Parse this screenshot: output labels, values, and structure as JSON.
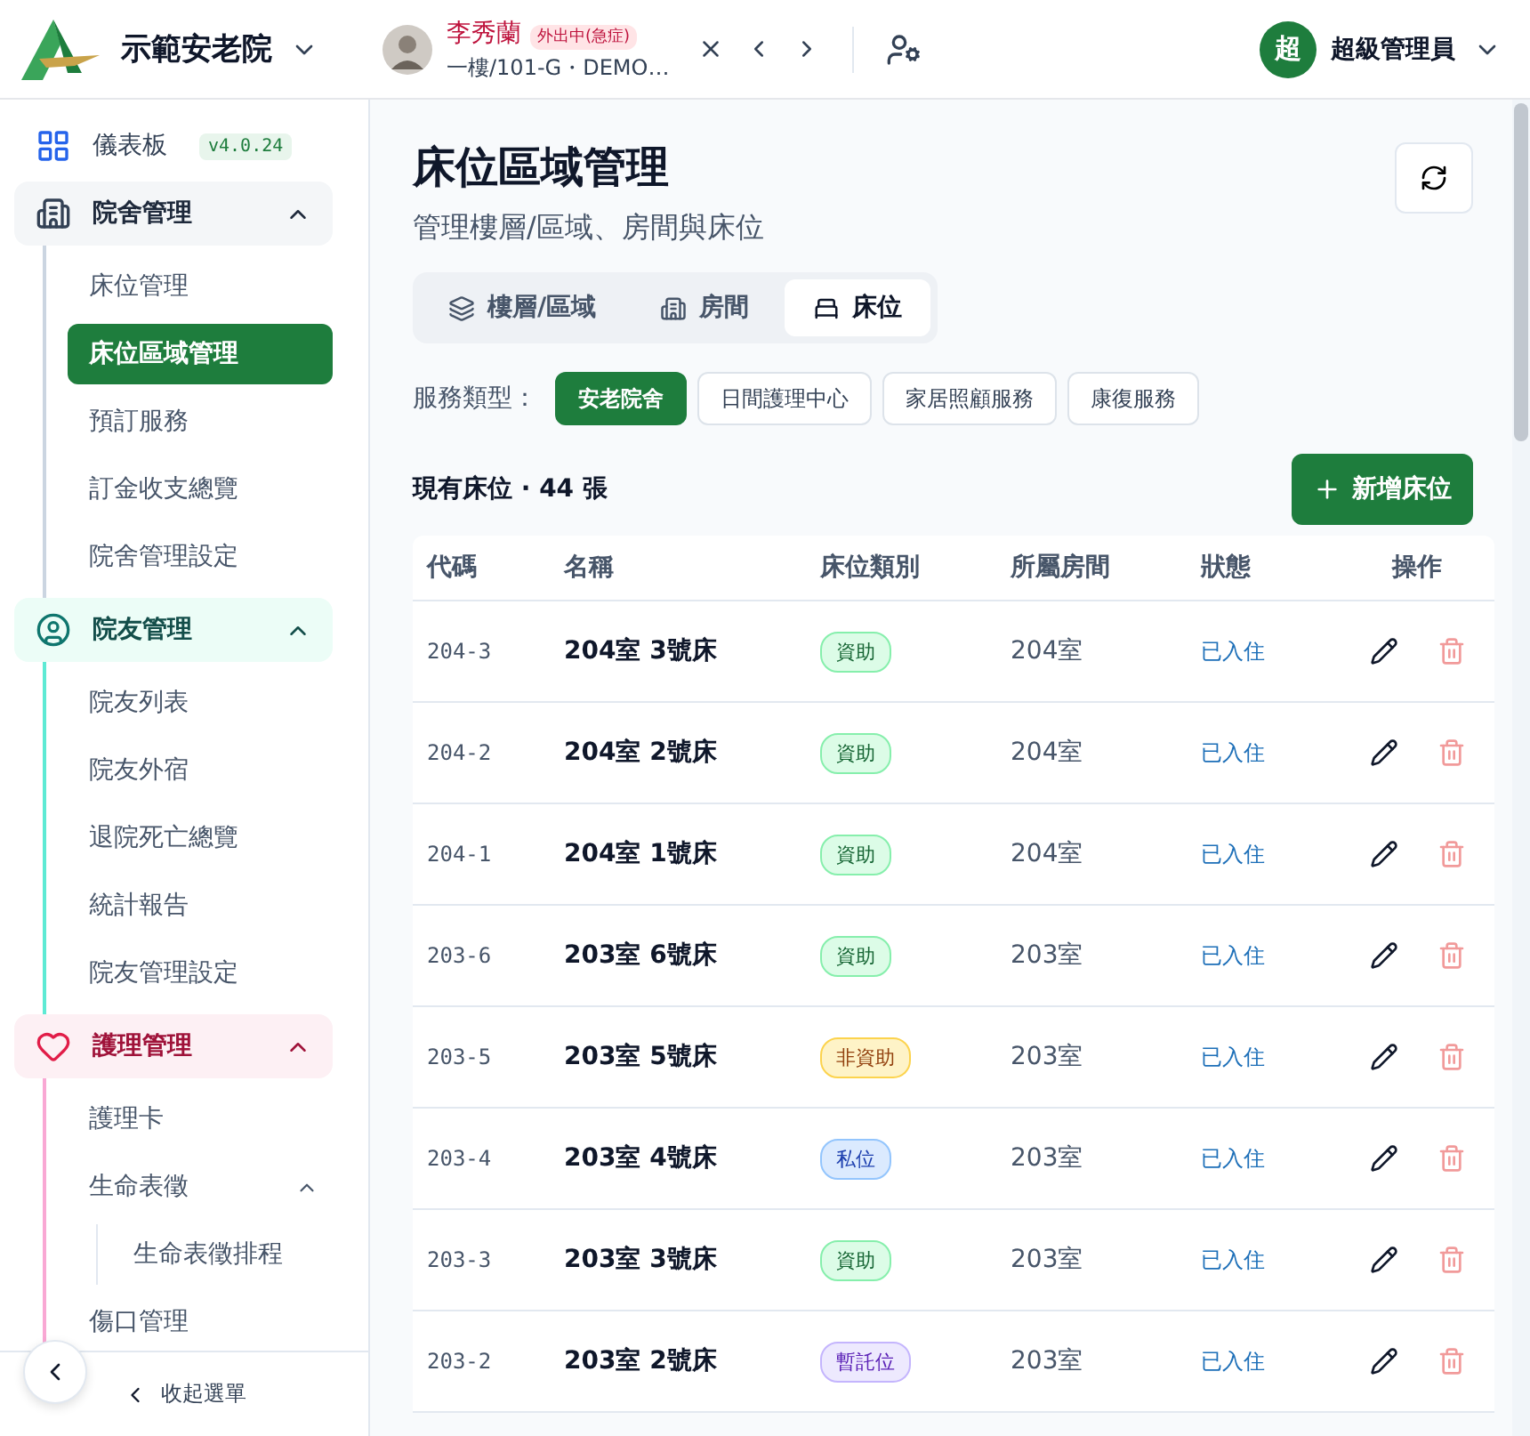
{
  "header": {
    "org_name": "示範安老院",
    "resident": {
      "name": "李秀蘭",
      "status_badge": "外出中(急症)",
      "location": "一樓/101-G・DEMO…"
    },
    "user": {
      "initial": "超",
      "name": "超級管理員"
    }
  },
  "sidebar": {
    "dashboard": {
      "label": "儀表板",
      "version": "v4.0.24"
    },
    "groups": [
      {
        "label": "院舍管理",
        "expanded": true,
        "color": "#cbd5e1",
        "items": [
          {
            "label": "床位管理",
            "selected": false
          },
          {
            "label": "床位區域管理",
            "selected": true
          },
          {
            "label": "預訂服務",
            "selected": false
          },
          {
            "label": "訂金收支總覽",
            "selected": false
          },
          {
            "label": "院舍管理設定",
            "selected": false
          }
        ]
      },
      {
        "label": "院友管理",
        "expanded": true,
        "color": "#5eead4",
        "items": [
          {
            "label": "院友列表",
            "selected": false
          },
          {
            "label": "院友外宿",
            "selected": false
          },
          {
            "label": "退院死亡總覽",
            "selected": false
          },
          {
            "label": "統計報告",
            "selected": false
          },
          {
            "label": "院友管理設定",
            "selected": false
          }
        ]
      },
      {
        "label": "護理管理",
        "expanded": true,
        "color": "#f9a8d4",
        "items": [
          {
            "label": "護理卡",
            "selected": false
          },
          {
            "label": "生命表徵",
            "selected": false,
            "expanded": true,
            "children": [
              {
                "label": "生命表徵排程",
                "selected": false
              }
            ]
          },
          {
            "label": "傷口管理",
            "selected": false
          }
        ]
      }
    ],
    "collapse_label": "收起選單"
  },
  "page": {
    "title": "床位區域管理",
    "subtitle": "管理樓層/區域、房間與床位",
    "tabs": [
      {
        "label": "樓層/區域",
        "selected": false
      },
      {
        "label": "房間",
        "selected": false
      },
      {
        "label": "床位",
        "selected": true
      }
    ],
    "filter_label": "服務類型：",
    "service_types": [
      {
        "label": "安老院舍",
        "selected": true
      },
      {
        "label": "日間護理中心",
        "selected": false
      },
      {
        "label": "家居照顧服務",
        "selected": false
      },
      {
        "label": "康復服務",
        "selected": false
      }
    ],
    "count_text": "現有床位 · 44 張",
    "add_button": "新增床位"
  },
  "table": {
    "columns": [
      "代碼",
      "名稱",
      "床位類別",
      "所屬房間",
      "狀態",
      "操作"
    ],
    "rows": [
      {
        "code": "204-3",
        "name": "204室 3號床",
        "category": {
          "label": "資助",
          "kind": "subsidized"
        },
        "room": "204室",
        "status": "已入住"
      },
      {
        "code": "204-2",
        "name": "204室 2號床",
        "category": {
          "label": "資助",
          "kind": "subsidized"
        },
        "room": "204室",
        "status": "已入住"
      },
      {
        "code": "204-1",
        "name": "204室 1號床",
        "category": {
          "label": "資助",
          "kind": "subsidized"
        },
        "room": "204室",
        "status": "已入住"
      },
      {
        "code": "203-6",
        "name": "203室 6號床",
        "category": {
          "label": "資助",
          "kind": "subsidized"
        },
        "room": "203室",
        "status": "已入住"
      },
      {
        "code": "203-5",
        "name": "203室 5號床",
        "category": {
          "label": "非資助",
          "kind": "non_subsidized"
        },
        "room": "203室",
        "status": "已入住"
      },
      {
        "code": "203-4",
        "name": "203室 4號床",
        "category": {
          "label": "私位",
          "kind": "private"
        },
        "room": "203室",
        "status": "已入住"
      },
      {
        "code": "203-3",
        "name": "203室 3號床",
        "category": {
          "label": "資助",
          "kind": "subsidized"
        },
        "room": "203室",
        "status": "已入住"
      },
      {
        "code": "203-2",
        "name": "203室 2號床",
        "category": {
          "label": "暫託位",
          "kind": "respite"
        },
        "room": "203室",
        "status": "已入住"
      }
    ]
  }
}
